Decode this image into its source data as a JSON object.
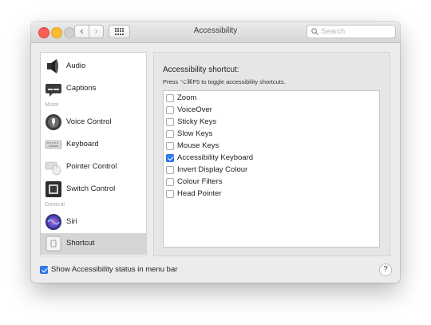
{
  "window": {
    "title": "Accessibility"
  },
  "toolbar": {
    "back_icon": "chevron-left-icon",
    "forward_icon": "chevron-right-icon",
    "show_all_icon": "grid-icon",
    "back_glyph": "‹",
    "forward_glyph": "›"
  },
  "search": {
    "placeholder": "Search",
    "value": ""
  },
  "sidebar": {
    "items": [
      {
        "label": "Audio",
        "icon": "speaker-icon",
        "selected": false
      },
      {
        "label": "Captions",
        "icon": "captions-icon",
        "selected": false
      },
      {
        "label": "Voice Control",
        "icon": "voice-control-icon",
        "selected": false
      },
      {
        "label": "Keyboard",
        "icon": "keyboard-icon",
        "selected": false
      },
      {
        "label": "Pointer Control",
        "icon": "pointer-control-icon",
        "selected": false
      },
      {
        "label": "Switch Control",
        "icon": "switch-control-icon",
        "selected": false
      },
      {
        "label": "Siri",
        "icon": "siri-icon",
        "selected": false
      },
      {
        "label": "Shortcut",
        "icon": "shortcut-icon",
        "selected": true
      }
    ],
    "sections": {
      "motor": "Motor",
      "general": "General"
    }
  },
  "content": {
    "heading": "Accessibility shortcut:",
    "subheading": "Press ⌥⌘F5 to toggle accessibility shortcuts.",
    "options": [
      {
        "label": "Zoom",
        "checked": false
      },
      {
        "label": "VoiceOver",
        "checked": false
      },
      {
        "label": "Sticky Keys",
        "checked": false
      },
      {
        "label": "Slow Keys",
        "checked": false
      },
      {
        "label": "Mouse Keys",
        "checked": false
      },
      {
        "label": "Accessibility Keyboard",
        "checked": true
      },
      {
        "label": "Invert Display Colour",
        "checked": false
      },
      {
        "label": "Colour Filters",
        "checked": false
      },
      {
        "label": "Head Pointer",
        "checked": false
      }
    ]
  },
  "footer": {
    "show_status_label": "Show Accessibility status in menu bar",
    "show_status_checked": true,
    "help_label": "?"
  },
  "colors": {
    "accent": "#2e7cf6",
    "selection": "#d5d5d5"
  }
}
